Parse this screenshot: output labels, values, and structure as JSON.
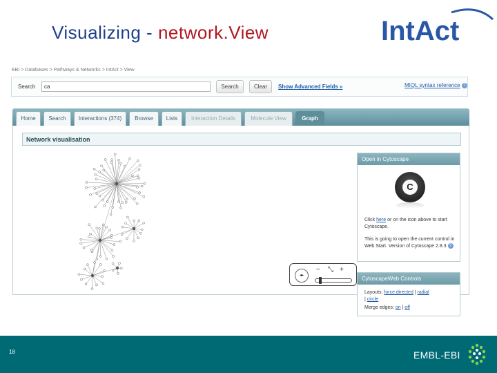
{
  "slide": {
    "title_part1": "Visualizing - ",
    "title_part2": "network.View",
    "page_number": "18"
  },
  "logo": {
    "text": "IntAct"
  },
  "breadcrumb": "EBI > Databases > Pathways & Networks > IntAct > View",
  "search": {
    "label": "Search",
    "value": "ca",
    "search_button": "Search",
    "clear_button": "Clear",
    "advanced_link": "Show Advanced Fields »",
    "miql_link": "MIQL syntax reference"
  },
  "tabs": [
    {
      "label": "Home",
      "state": "normal"
    },
    {
      "label": "Search",
      "state": "normal"
    },
    {
      "label": "Interactions (374)",
      "state": "normal"
    },
    {
      "label": "Browse",
      "state": "normal"
    },
    {
      "label": "Lists",
      "state": "normal"
    },
    {
      "label": "Interaction Details",
      "state": "disabled"
    },
    {
      "label": "Molecule View",
      "state": "disabled"
    },
    {
      "label": "Graph",
      "state": "active"
    }
  ],
  "network_panel": {
    "title": "Network visualisation"
  },
  "zoom_controls": {
    "zoom_out": "−",
    "fit": "⤡",
    "zoom_in": "+",
    "zoom_level": 0.1
  },
  "cytoscape_panel": {
    "title": "Open in Cytoscape",
    "logo_letter": "C",
    "text_click": "Click",
    "text_here": "here",
    "text_after_here": "or on the icon above to start Cytoscape.",
    "text_version": "This is going to open the current control in Web Start. Version of Cytoscape 2.8.3"
  },
  "cytoscape_web_controls": {
    "title": "CytoscapeWeb Controls",
    "layouts_label": "Layouts:",
    "layout_force": "force directed",
    "separator": "|",
    "layout_radial": "radial",
    "layout_circle": "circle",
    "merge_label": "Merge edges:",
    "merge_on": "on",
    "merge_off": "off"
  },
  "footer": {
    "org_name": "EMBL-EBI"
  },
  "colors": {
    "title_blue": "#1f3f8a",
    "title_red": "#b0171f",
    "tab_teal": "#5e8e9a",
    "footer_teal": "#006a74",
    "link_blue": "#1e5aa8"
  }
}
